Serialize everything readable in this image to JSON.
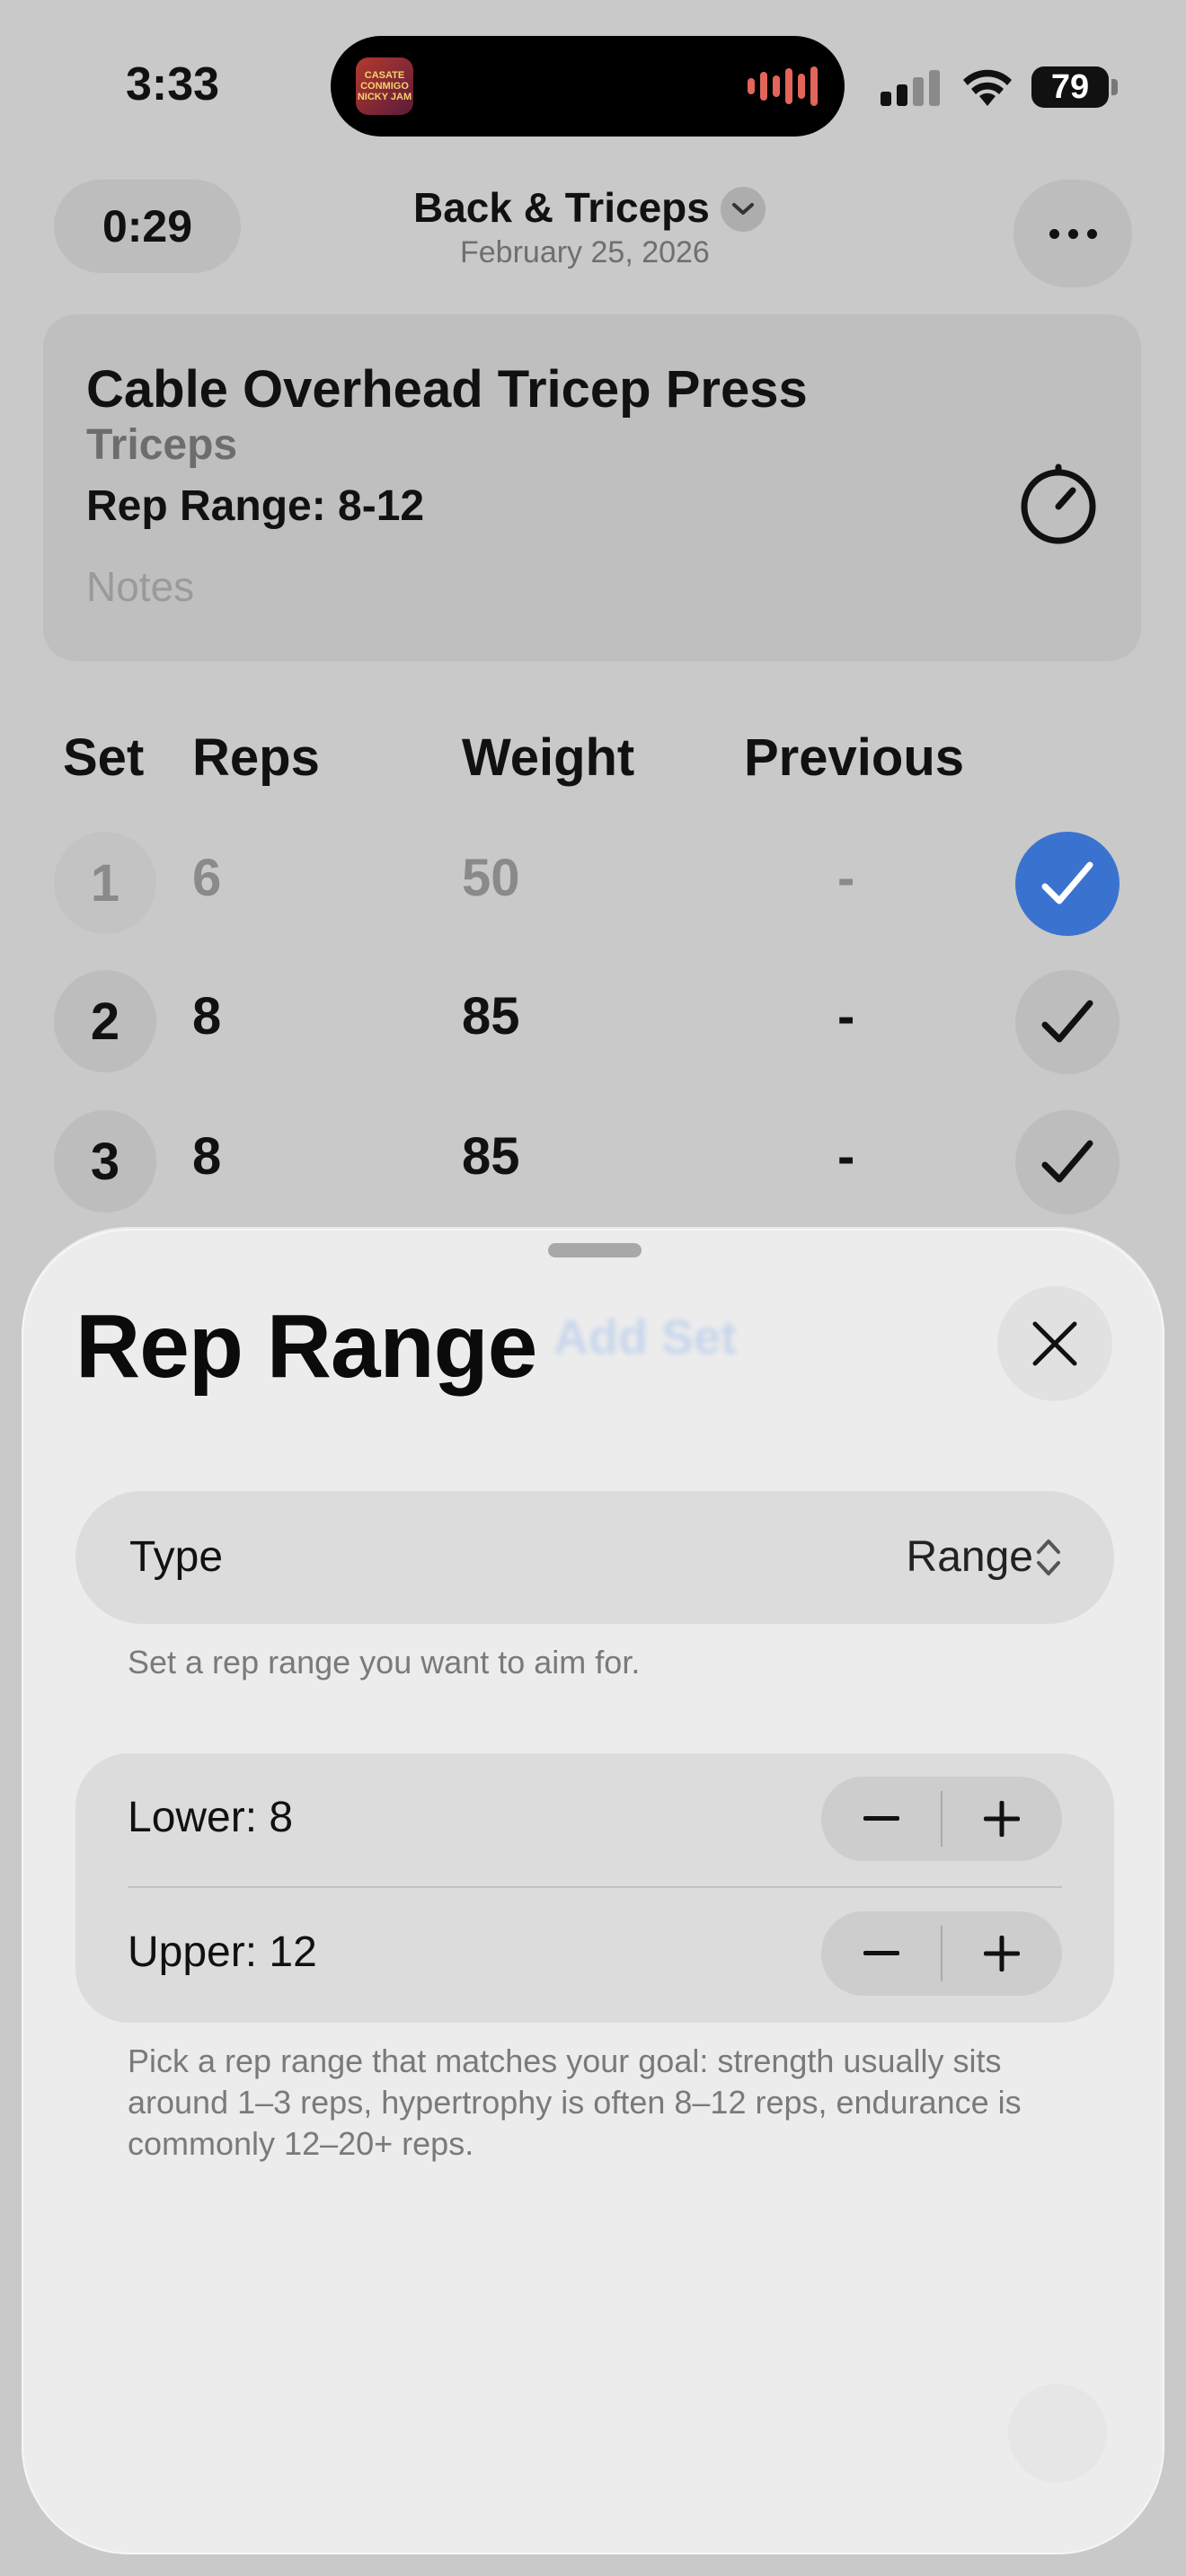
{
  "status_bar": {
    "time": "3:33",
    "battery": "79",
    "now_playing_art_text": "CASATE CONMIGO NICKY JAM"
  },
  "header": {
    "elapsed_timer": "0:29",
    "workout_title": "Back & Triceps",
    "workout_date": "February 25, 2026"
  },
  "exercise": {
    "name": "Cable Overhead Tricep Press",
    "muscle": "Triceps",
    "rep_range": "Rep Range: 8-12",
    "notes_placeholder": "Notes"
  },
  "sets_table": {
    "columns": [
      "Set",
      "Reps",
      "Weight",
      "Previous"
    ],
    "rows": [
      {
        "set": "1",
        "reps": "6",
        "weight": "50",
        "previous": "-",
        "completed": true
      },
      {
        "set": "2",
        "reps": "8",
        "weight": "85",
        "previous": "-",
        "completed": false
      },
      {
        "set": "3",
        "reps": "8",
        "weight": "85",
        "previous": "-",
        "completed": false
      }
    ],
    "add_set_label": "Add Set"
  },
  "sheet": {
    "title": "Rep Range",
    "type_label": "Type",
    "type_value": "Range",
    "type_help": "Set a rep range you want to aim for.",
    "lower_label": "Lower: 8",
    "upper_label": "Upper: 12",
    "range_help": "Pick a rep range that matches your goal: strength usually sits around 1–3 reps, hypertrophy is often 8–12 reps, endurance is commonly 12–20+ reps."
  },
  "colors": {
    "accent_blue": "#3a73cf",
    "sheet_bg": "#ececec",
    "dimmed_bg": "#c9c9c9"
  }
}
